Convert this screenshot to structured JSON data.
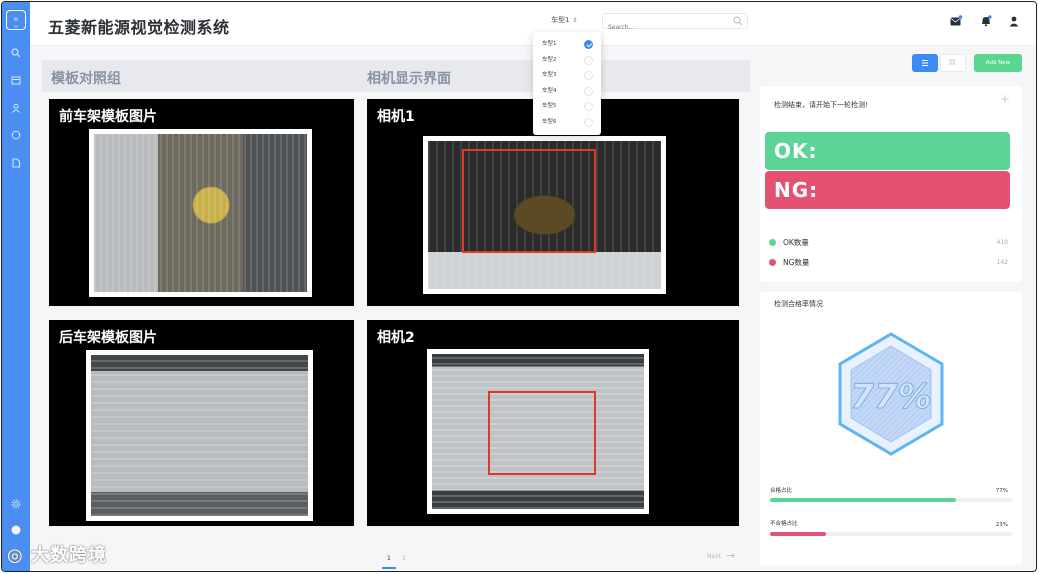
{
  "header": {
    "title": "五菱新能源视觉检测系统",
    "model_select": "车型1",
    "search_placeholder": "Search..."
  },
  "dropdown": {
    "items": [
      {
        "label": "车型1",
        "selected": true
      },
      {
        "label": "车型2",
        "selected": false
      },
      {
        "label": "车型3",
        "selected": false
      },
      {
        "label": "车型4",
        "selected": false
      },
      {
        "label": "车型5",
        "selected": false
      },
      {
        "label": "车型6",
        "selected": false
      }
    ]
  },
  "sections": {
    "template": "模板对照组",
    "camera": "相机显示界面"
  },
  "panels": {
    "front_template": "前车架模板图片",
    "rear_template": "后车架模板图片",
    "camera1": "相机1",
    "camera2": "相机2"
  },
  "pager": {
    "current": "1",
    "next_page": "2",
    "next_label": "Next"
  },
  "toolbar": {
    "add_label": "Add New"
  },
  "status_card": {
    "message": "检测结束，请开始下一轮检测!",
    "ok_label": "OK:",
    "ng_label": "NG:",
    "ok_count_label": "OK数量",
    "ok_count": "410",
    "ng_count_label": "NG数量",
    "ng_count": "142"
  },
  "rate_card": {
    "title": "检测合格率情况",
    "pass_rate": "77%",
    "pass_label": "合格占比",
    "pass_pct": "77%",
    "pass_fraction": 0.77,
    "fail_label": "不合格占比",
    "fail_pct": "23%",
    "fail_fraction": 0.23
  },
  "colors": {
    "accent": "#3d8bf2",
    "ok": "#5cd496",
    "ng": "#e45271"
  },
  "watermark": "大数跨境"
}
